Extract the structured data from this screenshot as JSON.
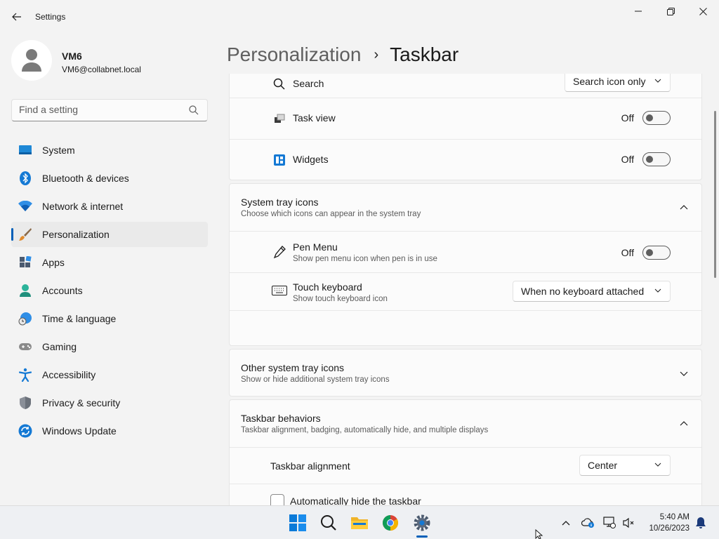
{
  "window": {
    "title": "Settings",
    "controls": [
      "minimize",
      "maximize",
      "close"
    ]
  },
  "profile": {
    "name": "VM6",
    "email": "VM6@collabnet.local"
  },
  "search": {
    "placeholder": "Find a setting"
  },
  "sidebar": {
    "items": [
      {
        "label": "System",
        "icon": "system-icon"
      },
      {
        "label": "Bluetooth & devices",
        "icon": "bluetooth-icon"
      },
      {
        "label": "Network & internet",
        "icon": "wifi-icon"
      },
      {
        "label": "Personalization",
        "icon": "brush-icon",
        "active": true
      },
      {
        "label": "Apps",
        "icon": "apps-icon"
      },
      {
        "label": "Accounts",
        "icon": "account-icon"
      },
      {
        "label": "Time & language",
        "icon": "globe-clock-icon"
      },
      {
        "label": "Gaming",
        "icon": "gamepad-icon"
      },
      {
        "label": "Accessibility",
        "icon": "accessibility-icon"
      },
      {
        "label": "Privacy & security",
        "icon": "shield-icon"
      },
      {
        "label": "Windows Update",
        "icon": "update-icon"
      }
    ]
  },
  "breadcrumb": {
    "parent": "Personalization",
    "separator": "›",
    "current": "Taskbar"
  },
  "taskbar_items": {
    "search": {
      "label": "Search",
      "value": "Search icon only"
    },
    "task_view": {
      "label": "Task view",
      "state": "Off"
    },
    "widgets": {
      "label": "Widgets",
      "state": "Off"
    }
  },
  "system_tray": {
    "title": "System tray icons",
    "subtitle": "Choose which icons can appear in the system tray",
    "pen_menu": {
      "label": "Pen Menu",
      "sub": "Show pen menu icon when pen is in use",
      "state": "Off"
    },
    "touch_keyboard": {
      "label": "Touch keyboard",
      "sub": "Show touch keyboard icon",
      "value": "When no keyboard attached"
    }
  },
  "other_tray": {
    "title": "Other system tray icons",
    "subtitle": "Show or hide additional system tray icons"
  },
  "behaviors": {
    "title": "Taskbar behaviors",
    "subtitle": "Taskbar alignment, badging, automatically hide, and multiple displays",
    "alignment": {
      "label": "Taskbar alignment",
      "value": "Center"
    },
    "auto_hide": {
      "label": "Automatically hide the taskbar",
      "checked": false
    }
  },
  "os_taskbar": {
    "apps": [
      "start-icon",
      "search-icon",
      "file-explorer-icon",
      "chrome-icon",
      "settings-icon"
    ],
    "time": "5:40 AM",
    "date": "10/26/2023"
  },
  "colors": {
    "accent": "#005fb8",
    "background": "#f3f3f3",
    "card": "#fbfbfb"
  }
}
